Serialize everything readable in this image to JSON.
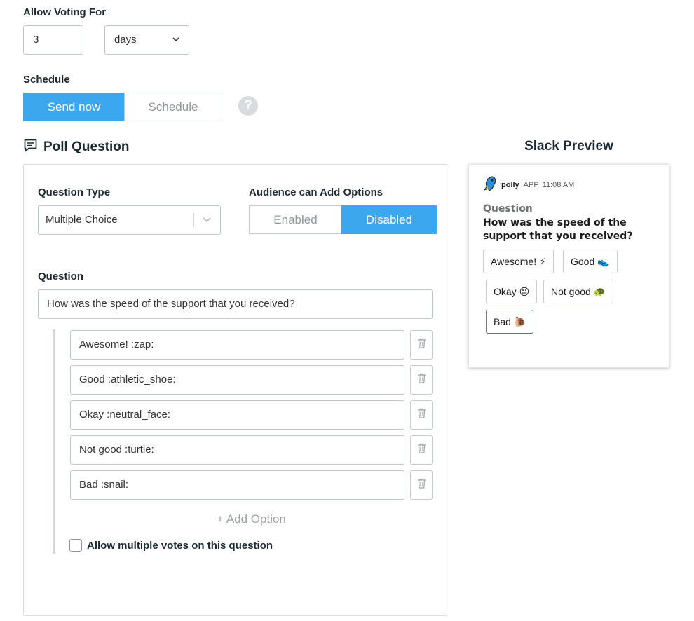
{
  "allow_voting": {
    "label": "Allow Voting For",
    "amount": "3",
    "unit": "days"
  },
  "schedule": {
    "label": "Schedule",
    "send_now": "Send now",
    "schedule": "Schedule",
    "selected": "Send now",
    "help_icon": "?"
  },
  "poll": {
    "title": "Poll Question",
    "question_type_label": "Question Type",
    "question_type_value": "Multiple Choice",
    "audience_label": "Audience can Add Options",
    "audience_enabled": "Enabled",
    "audience_disabled": "Disabled",
    "audience_selected": "Disabled",
    "question_label": "Question",
    "question_value": "How was the speed of the support that you received?",
    "options": [
      "Awesome! :zap:",
      "Good :athletic_shoe:",
      "Okay :neutral_face:",
      "Not good :turtle:",
      "Bad :snail:"
    ],
    "add_option": "+ Add Option",
    "multi_votes_prefix": "Allow ",
    "multi_votes_bold": "multiple votes",
    "multi_votes_suffix": " on this question",
    "multi_votes_checked": false
  },
  "preview": {
    "title": "Slack Preview",
    "bot_name": "polly",
    "app_tag": "APP",
    "time": "11:08 AM",
    "question_label": "Question",
    "question_text": "How was the speed of the support that you received?",
    "buttons": [
      {
        "label": "Awesome!",
        "emoji": "⚡"
      },
      {
        "label": "Good",
        "emoji": "👟"
      },
      {
        "label": "Okay",
        "emoji": "😐"
      },
      {
        "label": "Not good",
        "emoji": "🐢"
      },
      {
        "label": "Bad",
        "emoji": "🐌"
      }
    ]
  },
  "colors": {
    "accent": "#3aa7ef",
    "text": "#1d2b36",
    "muted": "#8f979e"
  }
}
